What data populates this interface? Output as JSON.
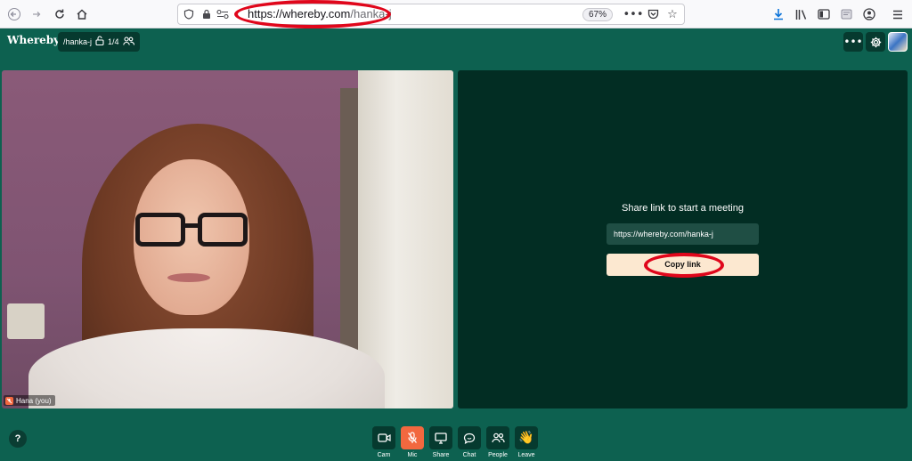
{
  "browser": {
    "url_host": "https://whereby.com",
    "url_path": "/hanka-j",
    "zoom": "67%"
  },
  "app": {
    "logo": "Whereby",
    "room_name": "/hanka-j",
    "participant_count": "1/4"
  },
  "video": {
    "self_label": "Hana (you)"
  },
  "share": {
    "title": "Share link to start a meeting",
    "link": "https://whereby.com/hanka-j",
    "copy_label": "Copy link"
  },
  "controls": {
    "help": "?",
    "cam": "Cam",
    "mic": "Mic",
    "share": "Share",
    "chat": "Chat",
    "people": "People",
    "leave": "Leave"
  },
  "colors": {
    "background": "#0d6150",
    "panel": "#022d23",
    "accent": "#f2683f",
    "copy_button": "#fce8d0",
    "annotation": "#e0061b"
  }
}
